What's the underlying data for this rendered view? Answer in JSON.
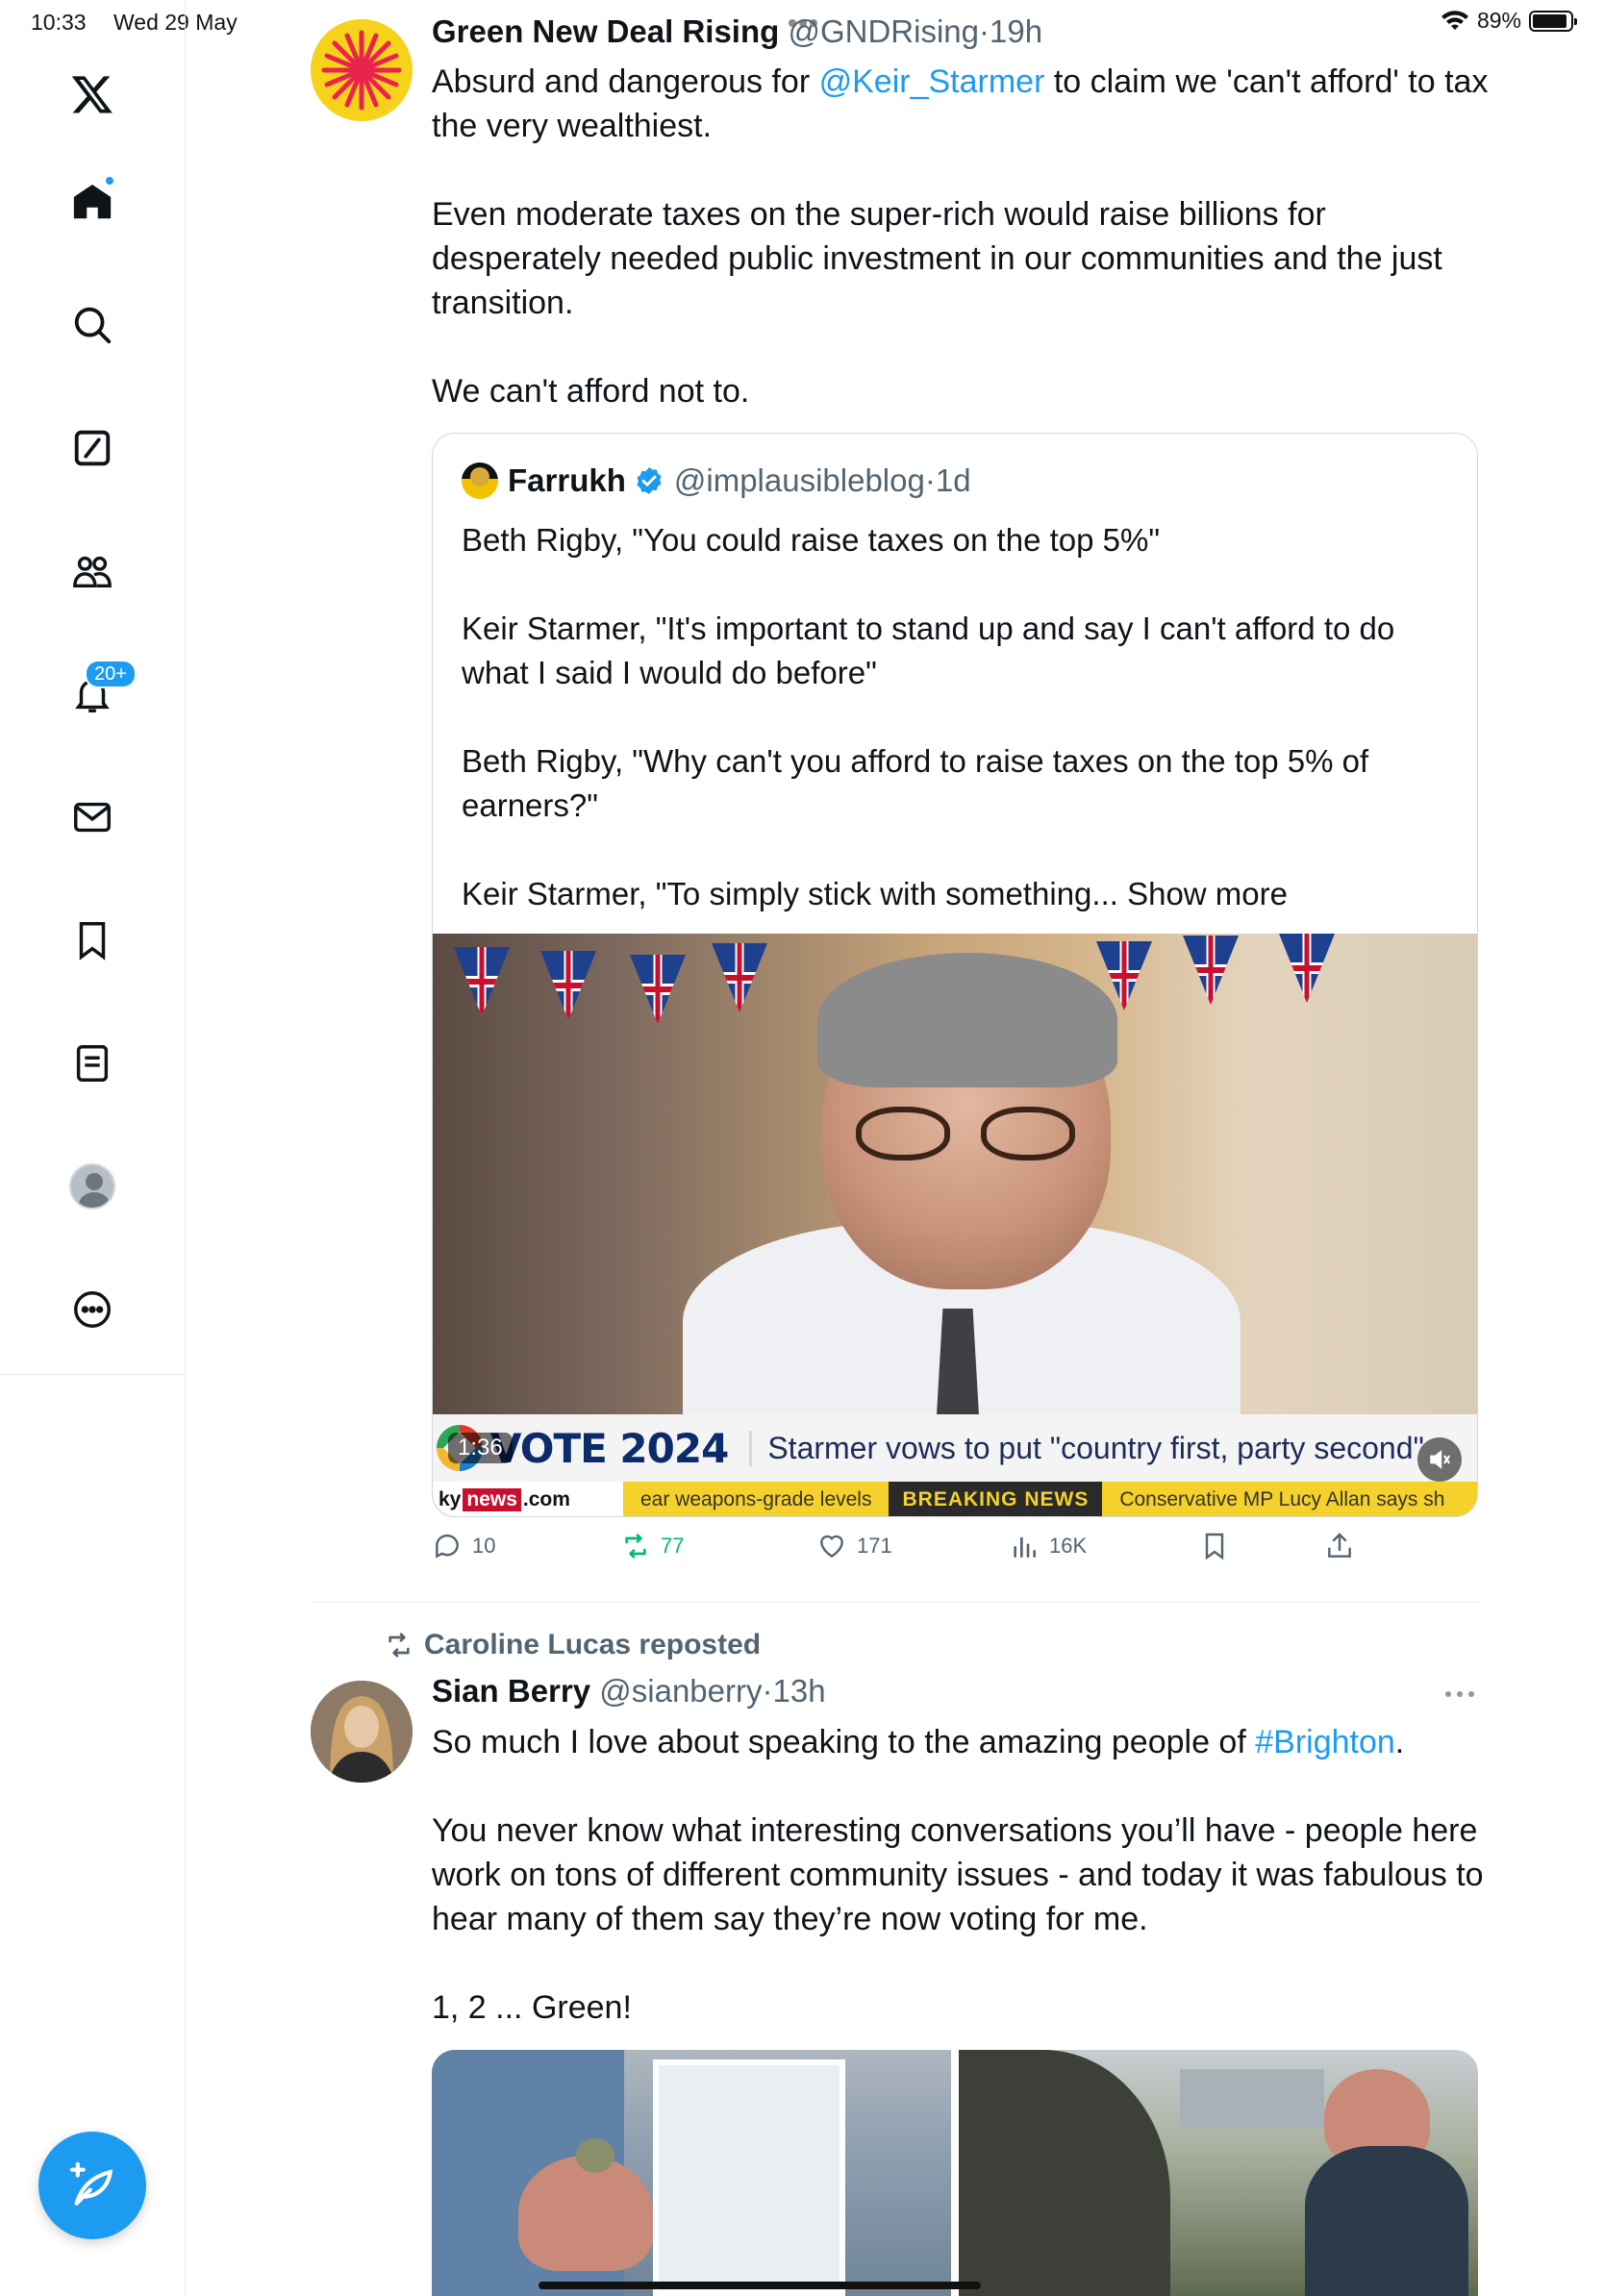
{
  "status_bar": {
    "time": "10:33",
    "date": "Wed 29 May",
    "battery": "89%",
    "battery_level": 0.89
  },
  "sidebar": {
    "notifications_badge": "20+",
    "icons": [
      "x-logo-icon",
      "home-icon",
      "search-icon",
      "grok-icon",
      "communities-icon",
      "notifications-icon",
      "messages-icon",
      "bookmarks-icon",
      "lists-icon",
      "profile-avatar",
      "more-icon",
      "compose-icon"
    ]
  },
  "tweet1": {
    "display_name": "Green New Deal Rising",
    "handle": "@GNDRising",
    "separator": "·",
    "time": "19h",
    "line1_before": "Absurd and dangerous for ",
    "mention": "@Keir_Starmer",
    "line1_after": " to claim we 'can't afford' to tax the very wealthiest.",
    "para2": "Even moderate taxes on the super-rich would raise billions for desperately needed public investment in our communities and the just transition.",
    "para3": "We can't afford not to.",
    "quote": {
      "display_name": "Farrukh",
      "handle": "@implausibleblog",
      "separator": "·",
      "time": "1d",
      "para1": "Beth Rigby, \"You could raise taxes on the top 5%\"",
      "para2": "Keir Starmer, \"It's important to stand up and say I can't afford to do what I said I would do before\"",
      "para3": "Beth Rigby, \"Why can't you afford to raise taxes on the top 5% of earners?\"",
      "para4": "Keir Starmer, \"To simply stick with something...",
      "show_more": "Show more",
      "video": {
        "vote_label": "VOTE 2024",
        "headline": "Starmer vows to put \"country first, party second\"",
        "duration": "1:36",
        "ticker_sky": "ky",
        "ticker_news": "news",
        "ticker_com": ".com",
        "ticker_item1": "ear weapons-grade levels",
        "ticker_breaking": "BREAKING NEWS",
        "ticker_item2": "Conservative MP Lucy Allan says sh"
      }
    },
    "actions": {
      "replies": "10",
      "reposts": "77",
      "likes": "171",
      "views": "16K"
    },
    "colors": {
      "repost_active": "#00ba7c",
      "accent": "#1d9bf0"
    }
  },
  "tweet2": {
    "repost_label": "Caroline Lucas reposted",
    "display_name": "Sian Berry",
    "handle": "@sianberry",
    "separator": "·",
    "time": "13h",
    "line1_before": "So much I love about speaking to the amazing people of ",
    "hashtag": "#Brighton",
    "line1_after": ".",
    "para2": "You never know what interesting conversations you’ll have - people here work on tons of different community issues - and today it was fabulous to hear many of them say they’re now voting for me.",
    "para3": "1, 2 ... Green!"
  }
}
